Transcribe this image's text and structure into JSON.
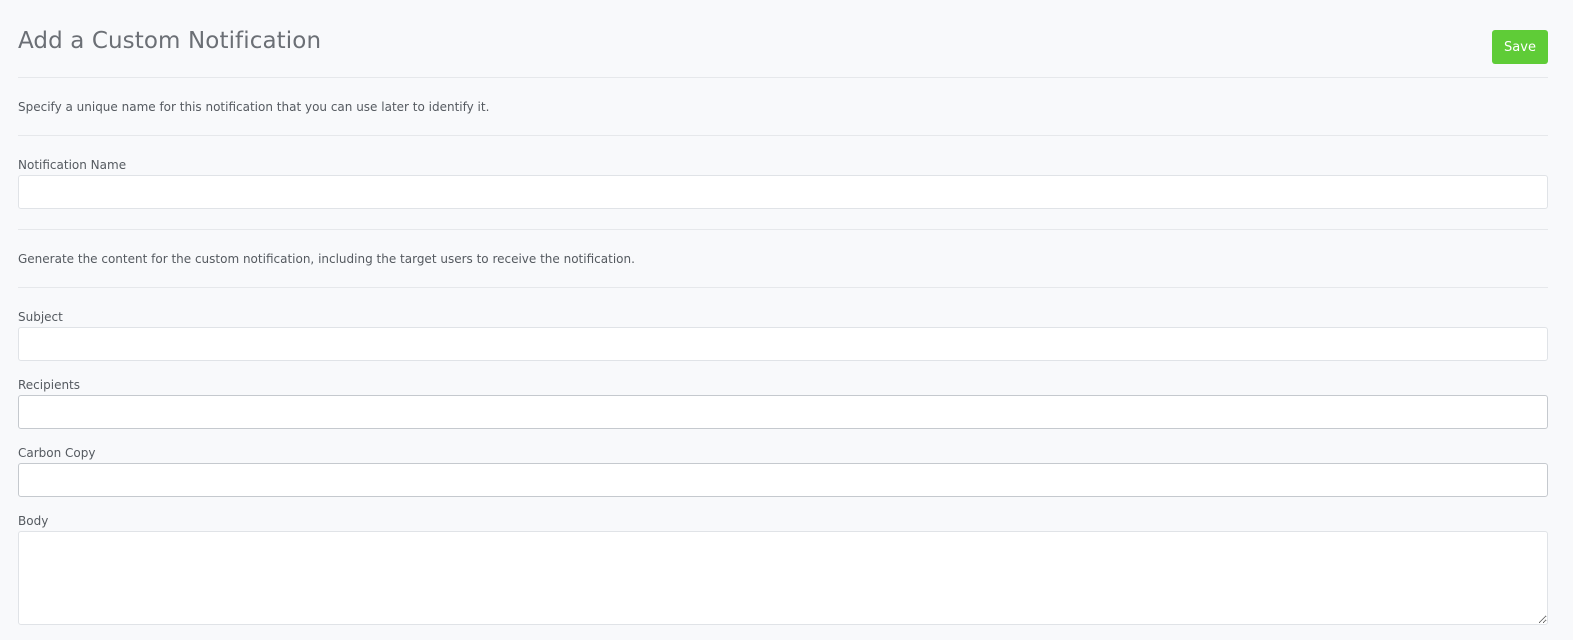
{
  "header": {
    "title": "Add a Custom Notification",
    "save_label": "Save"
  },
  "colors": {
    "accent_save": "#5fcc37",
    "background": "#f8f9fb"
  },
  "intro": {
    "name_hint": "Specify a unique name for this notification that you can use later to identify it.",
    "content_hint": "Generate the content for the custom notification, including the target users to receive the notification."
  },
  "fields": {
    "notification_name": {
      "label": "Notification Name",
      "value": ""
    },
    "subject": {
      "label": "Subject",
      "value": ""
    },
    "recipients": {
      "label": "Recipients",
      "value": ""
    },
    "carbon_copy": {
      "label": "Carbon Copy",
      "value": ""
    },
    "body": {
      "label": "Body",
      "value": ""
    }
  }
}
